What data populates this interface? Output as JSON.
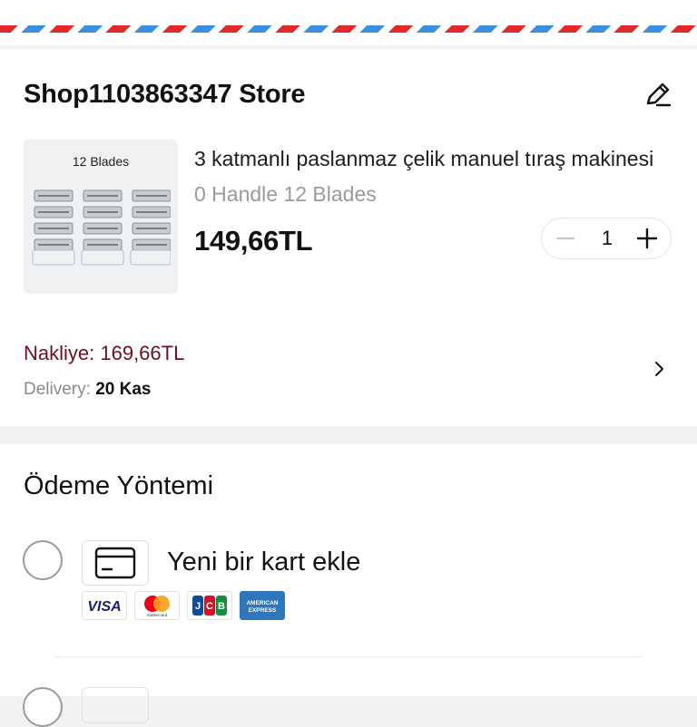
{
  "shop": {
    "name": "Shop1103863347 Store",
    "thumbnail_label": "12 Blades",
    "product_title": "3 katmanlı paslanmaz çelik manuel tıraş makinesi",
    "product_variant": "0 Handle 12 Blades",
    "price": "149,66TL",
    "quantity": "1",
    "shipping_text": "Nakliye: 169,66TL",
    "delivery_label": "Delivery:",
    "delivery_date": "20 Kas"
  },
  "payment": {
    "title": "Ödeme Yöntemi",
    "add_card_label": "Yeni bir kart ekle",
    "brands": [
      "VISA",
      "mastercard",
      "JCB",
      "AMERICAN EXPRESS"
    ]
  },
  "icons": {
    "edit": "pencil-edit-icon",
    "chevron": "chevron-right-icon",
    "card": "credit-card-icon",
    "minus": "minus-icon",
    "plus": "plus-icon"
  },
  "colors": {
    "shipping_text": "#6b1020",
    "airmail_red": "#e02a2a",
    "airmail_blue": "#3c8fe0",
    "visa_blue": "#1a1f71",
    "mastercard_red": "#eb001b",
    "mastercard_orange": "#f79e1b",
    "amex_blue": "#2e77bc"
  }
}
